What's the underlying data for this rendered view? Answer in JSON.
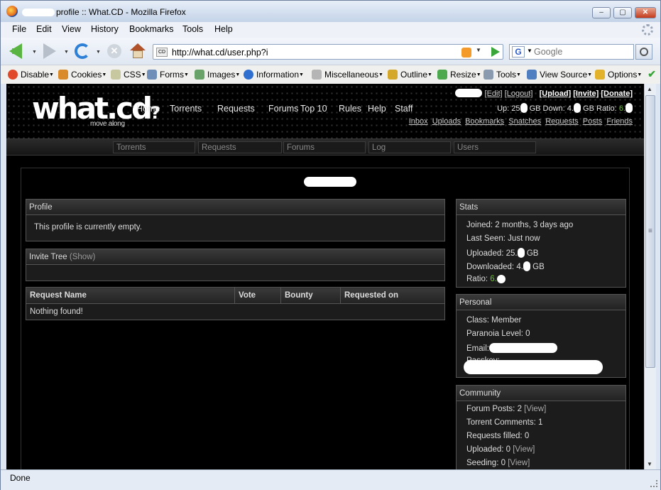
{
  "browser": {
    "title": "profile :: What.CD - Mozilla Firefox",
    "menu": [
      "File",
      "Edit",
      "View",
      "History",
      "Bookmarks",
      "Tools",
      "Help"
    ],
    "url": "http://what.cd/user.php?i",
    "search_placeholder": "Google",
    "status": "Done",
    "devtoolbar": [
      "Disable",
      "Cookies",
      "CSS",
      "Forms",
      "Images",
      "Information",
      "Miscellaneous",
      "Outline",
      "Resize",
      "Tools",
      "View Source",
      "Options"
    ]
  },
  "site": {
    "logo": "what.cd",
    "logo_suffix": "?",
    "tagline": "move along",
    "nav": [
      "Home",
      "Torrents",
      "Requests",
      "Forums",
      "Top 10",
      "Rules",
      "Help",
      "Staff"
    ],
    "user_links": {
      "edit": "[Edit]",
      "logout": "[Logout]",
      "upload": "[Upload]",
      "invite": "[Invite]",
      "donate": "[Donate]"
    },
    "ratio_line": {
      "up_label": "Up: 25",
      "up_unit": "GB",
      "down_label": "Down: 4.",
      "down_unit": "GB",
      "ratio_label": "Ratio:",
      "ratio_value": "6."
    },
    "quick_links": [
      "Inbox",
      "Uploads",
      "Bookmarks",
      "Snatches",
      "Requests",
      "Posts",
      "Friends"
    ],
    "subnav_search": [
      "Torrents",
      "Requests",
      "Forums",
      "Log",
      "Users"
    ]
  },
  "profile": {
    "box_title": "Profile",
    "body": "This profile is currently empty.",
    "invite_tree_title": "Invite Tree",
    "invite_tree_toggle": "(Show)"
  },
  "requests_table": {
    "headers": [
      "Request Name",
      "Vote",
      "Bounty",
      "Requested on"
    ],
    "empty": "Nothing found!"
  },
  "stats": {
    "title": "Stats",
    "joined": "Joined: 2 months, 3 days ago",
    "last_seen": "Last Seen: Just now",
    "uploaded_label": "Uploaded: 25.",
    "uploaded_unit": "GB",
    "downloaded_label": "Downloaded: 4.",
    "downloaded_unit": "GB",
    "ratio_label": "Ratio:",
    "ratio_value": "6."
  },
  "personal": {
    "title": "Personal",
    "class": "Class: Member",
    "paranoia": "Paranoia Level: 0",
    "email_label": "Email:",
    "passkey_label": "Passkey:"
  },
  "community": {
    "title": "Community",
    "forum_posts": "Forum Posts: 2",
    "torrent_comments": "Torrent Comments: 1",
    "requests_filled": "Requests filled: 0",
    "uploaded": "Uploaded: 0",
    "seeding": "Seeding: 0",
    "view_link": "[View]"
  },
  "colors": {
    "ratio_green": "#6cbf3a",
    "page_bg": "#000000",
    "box_bg": "#1c1c1c"
  }
}
